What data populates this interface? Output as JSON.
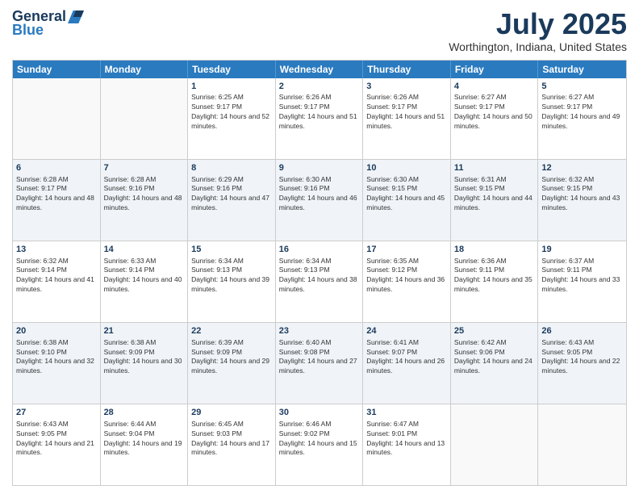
{
  "logo": {
    "general": "General",
    "blue": "Blue"
  },
  "title": "July 2025",
  "subtitle": "Worthington, Indiana, United States",
  "days": [
    "Sunday",
    "Monday",
    "Tuesday",
    "Wednesday",
    "Thursday",
    "Friday",
    "Saturday"
  ],
  "rows": [
    [
      {
        "day": "",
        "sunrise": "",
        "sunset": "",
        "daylight": "",
        "empty": true
      },
      {
        "day": "",
        "sunrise": "",
        "sunset": "",
        "daylight": "",
        "empty": true
      },
      {
        "day": "1",
        "sunrise": "Sunrise: 6:25 AM",
        "sunset": "Sunset: 9:17 PM",
        "daylight": "Daylight: 14 hours and 52 minutes."
      },
      {
        "day": "2",
        "sunrise": "Sunrise: 6:26 AM",
        "sunset": "Sunset: 9:17 PM",
        "daylight": "Daylight: 14 hours and 51 minutes."
      },
      {
        "day": "3",
        "sunrise": "Sunrise: 6:26 AM",
        "sunset": "Sunset: 9:17 PM",
        "daylight": "Daylight: 14 hours and 51 minutes."
      },
      {
        "day": "4",
        "sunrise": "Sunrise: 6:27 AM",
        "sunset": "Sunset: 9:17 PM",
        "daylight": "Daylight: 14 hours and 50 minutes."
      },
      {
        "day": "5",
        "sunrise": "Sunrise: 6:27 AM",
        "sunset": "Sunset: 9:17 PM",
        "daylight": "Daylight: 14 hours and 49 minutes."
      }
    ],
    [
      {
        "day": "6",
        "sunrise": "Sunrise: 6:28 AM",
        "sunset": "Sunset: 9:17 PM",
        "daylight": "Daylight: 14 hours and 48 minutes."
      },
      {
        "day": "7",
        "sunrise": "Sunrise: 6:28 AM",
        "sunset": "Sunset: 9:16 PM",
        "daylight": "Daylight: 14 hours and 48 minutes."
      },
      {
        "day": "8",
        "sunrise": "Sunrise: 6:29 AM",
        "sunset": "Sunset: 9:16 PM",
        "daylight": "Daylight: 14 hours and 47 minutes."
      },
      {
        "day": "9",
        "sunrise": "Sunrise: 6:30 AM",
        "sunset": "Sunset: 9:16 PM",
        "daylight": "Daylight: 14 hours and 46 minutes."
      },
      {
        "day": "10",
        "sunrise": "Sunrise: 6:30 AM",
        "sunset": "Sunset: 9:15 PM",
        "daylight": "Daylight: 14 hours and 45 minutes."
      },
      {
        "day": "11",
        "sunrise": "Sunrise: 6:31 AM",
        "sunset": "Sunset: 9:15 PM",
        "daylight": "Daylight: 14 hours and 44 minutes."
      },
      {
        "day": "12",
        "sunrise": "Sunrise: 6:32 AM",
        "sunset": "Sunset: 9:15 PM",
        "daylight": "Daylight: 14 hours and 43 minutes."
      }
    ],
    [
      {
        "day": "13",
        "sunrise": "Sunrise: 6:32 AM",
        "sunset": "Sunset: 9:14 PM",
        "daylight": "Daylight: 14 hours and 41 minutes."
      },
      {
        "day": "14",
        "sunrise": "Sunrise: 6:33 AM",
        "sunset": "Sunset: 9:14 PM",
        "daylight": "Daylight: 14 hours and 40 minutes."
      },
      {
        "day": "15",
        "sunrise": "Sunrise: 6:34 AM",
        "sunset": "Sunset: 9:13 PM",
        "daylight": "Daylight: 14 hours and 39 minutes."
      },
      {
        "day": "16",
        "sunrise": "Sunrise: 6:34 AM",
        "sunset": "Sunset: 9:13 PM",
        "daylight": "Daylight: 14 hours and 38 minutes."
      },
      {
        "day": "17",
        "sunrise": "Sunrise: 6:35 AM",
        "sunset": "Sunset: 9:12 PM",
        "daylight": "Daylight: 14 hours and 36 minutes."
      },
      {
        "day": "18",
        "sunrise": "Sunrise: 6:36 AM",
        "sunset": "Sunset: 9:11 PM",
        "daylight": "Daylight: 14 hours and 35 minutes."
      },
      {
        "day": "19",
        "sunrise": "Sunrise: 6:37 AM",
        "sunset": "Sunset: 9:11 PM",
        "daylight": "Daylight: 14 hours and 33 minutes."
      }
    ],
    [
      {
        "day": "20",
        "sunrise": "Sunrise: 6:38 AM",
        "sunset": "Sunset: 9:10 PM",
        "daylight": "Daylight: 14 hours and 32 minutes."
      },
      {
        "day": "21",
        "sunrise": "Sunrise: 6:38 AM",
        "sunset": "Sunset: 9:09 PM",
        "daylight": "Daylight: 14 hours and 30 minutes."
      },
      {
        "day": "22",
        "sunrise": "Sunrise: 6:39 AM",
        "sunset": "Sunset: 9:09 PM",
        "daylight": "Daylight: 14 hours and 29 minutes."
      },
      {
        "day": "23",
        "sunrise": "Sunrise: 6:40 AM",
        "sunset": "Sunset: 9:08 PM",
        "daylight": "Daylight: 14 hours and 27 minutes."
      },
      {
        "day": "24",
        "sunrise": "Sunrise: 6:41 AM",
        "sunset": "Sunset: 9:07 PM",
        "daylight": "Daylight: 14 hours and 26 minutes."
      },
      {
        "day": "25",
        "sunrise": "Sunrise: 6:42 AM",
        "sunset": "Sunset: 9:06 PM",
        "daylight": "Daylight: 14 hours and 24 minutes."
      },
      {
        "day": "26",
        "sunrise": "Sunrise: 6:43 AM",
        "sunset": "Sunset: 9:05 PM",
        "daylight": "Daylight: 14 hours and 22 minutes."
      }
    ],
    [
      {
        "day": "27",
        "sunrise": "Sunrise: 6:43 AM",
        "sunset": "Sunset: 9:05 PM",
        "daylight": "Daylight: 14 hours and 21 minutes."
      },
      {
        "day": "28",
        "sunrise": "Sunrise: 6:44 AM",
        "sunset": "Sunset: 9:04 PM",
        "daylight": "Daylight: 14 hours and 19 minutes."
      },
      {
        "day": "29",
        "sunrise": "Sunrise: 6:45 AM",
        "sunset": "Sunset: 9:03 PM",
        "daylight": "Daylight: 14 hours and 17 minutes."
      },
      {
        "day": "30",
        "sunrise": "Sunrise: 6:46 AM",
        "sunset": "Sunset: 9:02 PM",
        "daylight": "Daylight: 14 hours and 15 minutes."
      },
      {
        "day": "31",
        "sunrise": "Sunrise: 6:47 AM",
        "sunset": "Sunset: 9:01 PM",
        "daylight": "Daylight: 14 hours and 13 minutes."
      },
      {
        "day": "",
        "sunrise": "",
        "sunset": "",
        "daylight": "",
        "empty": true
      },
      {
        "day": "",
        "sunrise": "",
        "sunset": "",
        "daylight": "",
        "empty": true
      }
    ]
  ]
}
